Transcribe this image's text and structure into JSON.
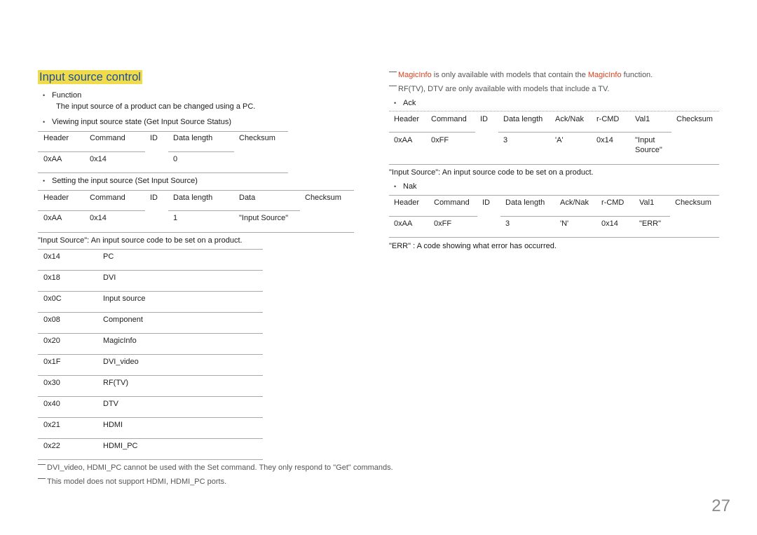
{
  "page": {
    "title": "Input source control",
    "page_number": "27"
  },
  "left": {
    "function_bullet": "Function",
    "function_desc": "The input source of a product can be changed using a PC.",
    "get_bullet": "Viewing input source state (Get Input Source Status)",
    "get_table": {
      "headers": [
        "Header",
        "Command",
        "ID",
        "Data length",
        "Checksum"
      ],
      "row": [
        "0xAA",
        "0x14",
        "",
        "0",
        ""
      ]
    },
    "set_bullet": "Setting the input source (Set Input Source)",
    "set_table": {
      "headers": [
        "Header",
        "Command",
        "ID",
        "Data length",
        "Data",
        "Checksum"
      ],
      "row": [
        "0xAA",
        "0x14",
        "",
        "1",
        "\"Input Source\"",
        ""
      ]
    },
    "input_source_desc": "\"Input Source\": An input source code to be set on a product.",
    "codes": [
      {
        "code": "0x14",
        "name": "PC"
      },
      {
        "code": "0x18",
        "name": "DVI"
      },
      {
        "code": "0x0C",
        "name": "Input source"
      },
      {
        "code": "0x08",
        "name": "Component"
      },
      {
        "code": "0x20",
        "name": "MagicInfo"
      },
      {
        "code": "0x1F",
        "name": "DVI_video"
      },
      {
        "code": "0x30",
        "name": "RF(TV)"
      },
      {
        "code": "0x40",
        "name": "DTV"
      },
      {
        "code": "0x21",
        "name": "HDMI"
      },
      {
        "code": "0x22",
        "name": "HDMI_PC"
      }
    ],
    "notes": [
      "DVI_video, HDMI_PC cannot be used with the Set command. They only respond to \"Get\" commands.",
      "This model does not support HDMI, HDMI_PC ports."
    ]
  },
  "right": {
    "note1": {
      "highlight1": "MagicInfo",
      "middle": " is only available with models that contain the ",
      "highlight2": "MagicInfo",
      "end": " function."
    },
    "note2": "RF(TV), DTV are only available with models that include a TV.",
    "ack_bullet": "Ack",
    "ack_table": {
      "headers": [
        "Header",
        "Command",
        "ID",
        "Data length",
        "Ack/Nak",
        "r-CMD",
        "Val1",
        "Checksum"
      ],
      "row": [
        "0xAA",
        "0xFF",
        "",
        "3",
        "'A'",
        "0x14",
        "\"Input",
        ""
      ],
      "val1_line2": "Source\""
    },
    "ack_desc": "\"Input Source\": An input source code to be set on a product.",
    "nak_bullet": "Nak",
    "nak_table": {
      "headers": [
        "Header",
        "Command",
        "ID",
        "Data length",
        "Ack/Nak",
        "r-CMD",
        "Val1",
        "Checksum"
      ],
      "row": [
        "0xAA",
        "0xFF",
        "",
        "3",
        "'N'",
        "0x14",
        "\"ERR\"",
        ""
      ]
    },
    "nak_desc": "\"ERR\" : A code showing what error has occurred."
  },
  "colors": {
    "title_highlight": "#f0dc4a",
    "title_text": "#1f4e9c",
    "magicinfo_red": "#d9431e"
  }
}
